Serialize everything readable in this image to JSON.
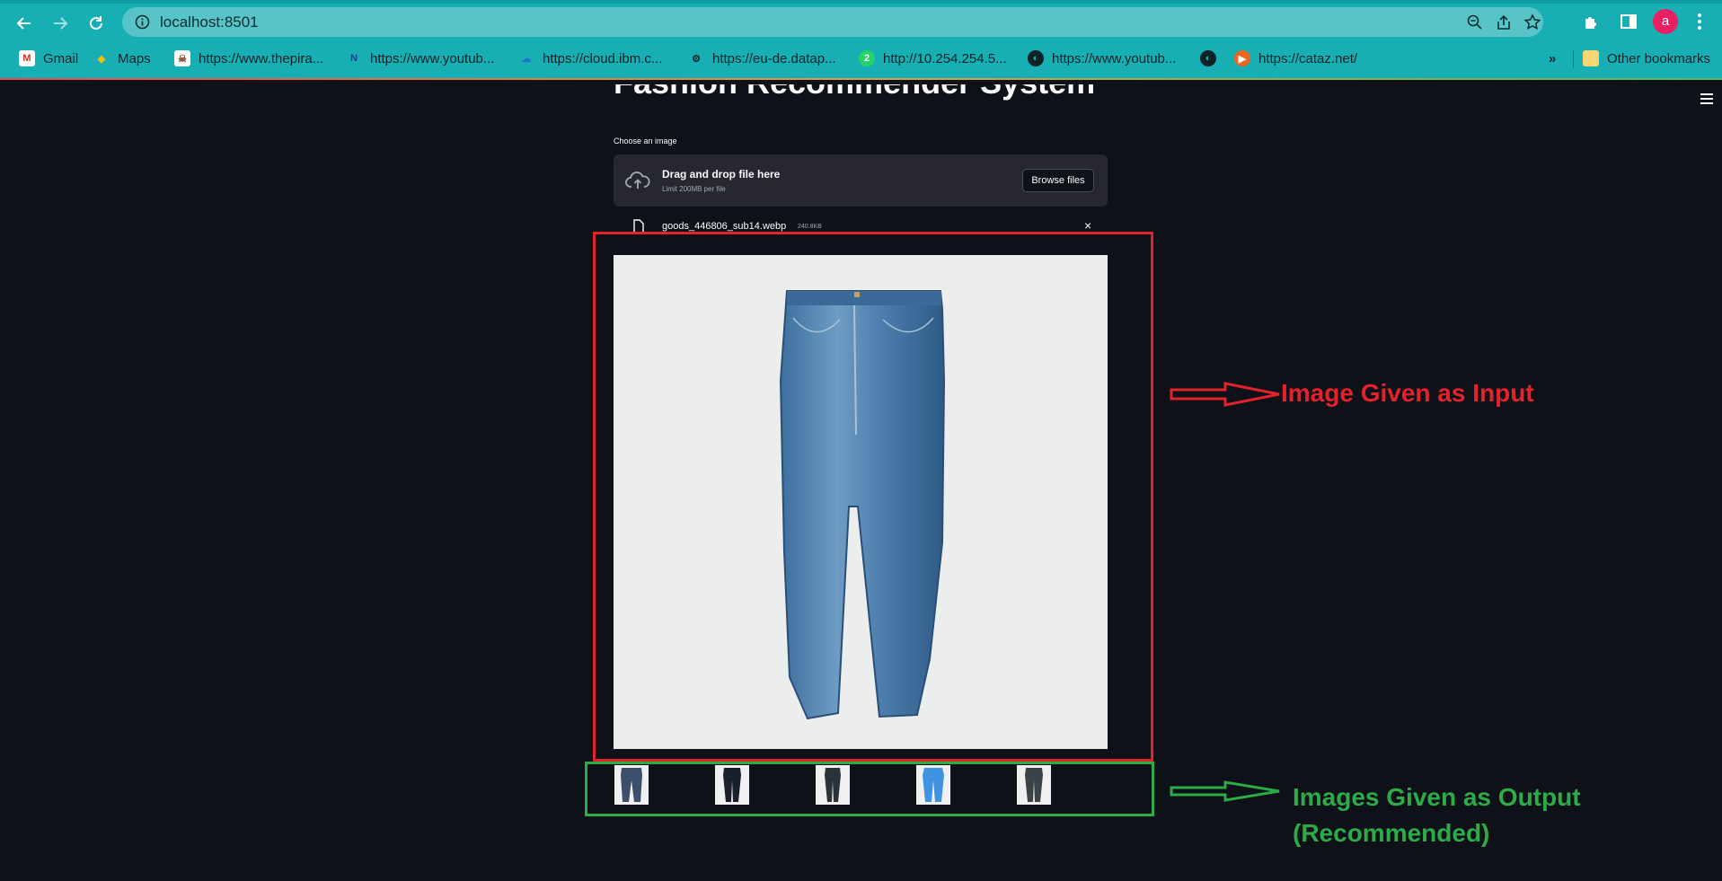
{
  "browser": {
    "url": "localhost:8501",
    "profile_initial": "a",
    "bookmarks": [
      {
        "label": "Gmail",
        "icon": "gmail-icon"
      },
      {
        "label": "Maps",
        "icon": "maps-icon"
      },
      {
        "label": "https://www.thepira...",
        "icon": "pirate-icon"
      },
      {
        "label": "https://www.youtub...",
        "icon": "n-logo-icon"
      },
      {
        "label": "https://cloud.ibm.c...",
        "icon": "cloud-icon"
      },
      {
        "label": "https://eu-de.datap...",
        "icon": "gear-icon"
      },
      {
        "label": "http://10.254.254.5...",
        "icon": "whatsapp-icon"
      },
      {
        "label": "https://www.youtub...",
        "icon": "globe-icon"
      },
      {
        "label": "",
        "icon": "globe-icon"
      },
      {
        "label": "https://cataz.net/",
        "icon": "play-icon"
      }
    ],
    "overflow": "»",
    "other_bookmarks": "Other bookmarks"
  },
  "app": {
    "title": "Fashion Recommender System",
    "uploader": {
      "label": "Choose an image",
      "drop_text": "Drag and drop file here",
      "limit_text": "Limit 200MB per file",
      "browse_label": "Browse files"
    },
    "uploaded_file": {
      "name": "goods_446806_sub14.webp",
      "size": "240.8KB",
      "close": "×"
    },
    "recommendations": [
      {
        "icon": "jeans-dark-blue-icon"
      },
      {
        "icon": "jeans-black-icon"
      },
      {
        "icon": "jeans-charcoal-icon"
      },
      {
        "icon": "jeans-light-blue-icon"
      },
      {
        "icon": "jeans-grey-icon"
      }
    ]
  },
  "annotations": {
    "input_label": "Image Given as Input",
    "output_label_line1": "Images Given as Output",
    "output_label_line2": "(Recommended)",
    "colors": {
      "input": "#e3222c",
      "output": "#2cab48"
    }
  },
  "colors": {
    "chrome": "#17aeb4",
    "app_background": "#0e1117",
    "dropzone": "#262730"
  }
}
